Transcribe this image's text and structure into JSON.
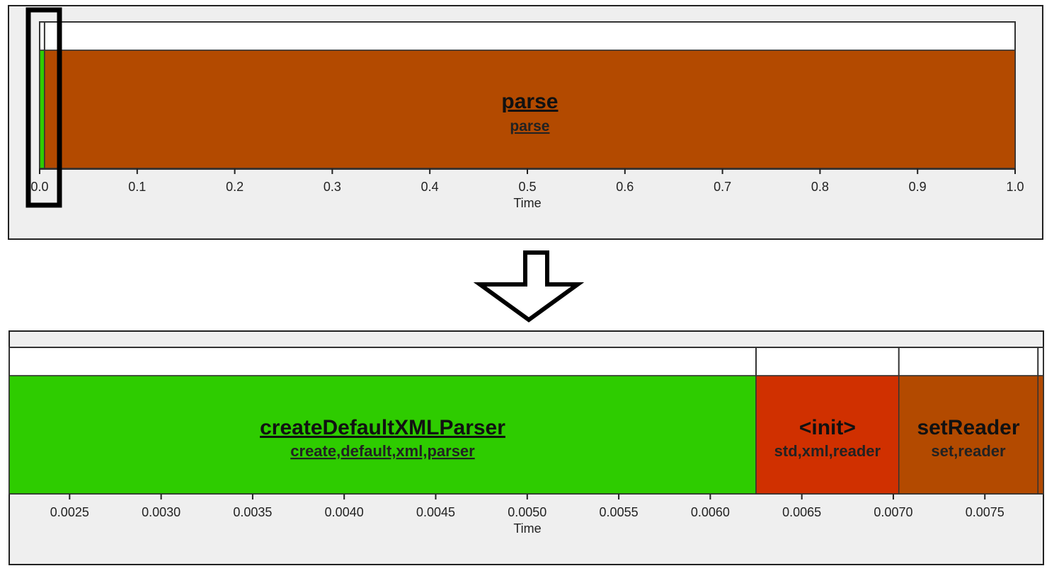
{
  "chart_data": [
    {
      "type": "timeline",
      "xlabel": "Time",
      "xlim": [
        0.0,
        1.0
      ],
      "ticks": [
        {
          "value": 0.0,
          "label": "0.0"
        },
        {
          "value": 0.1,
          "label": "0.1"
        },
        {
          "value": 0.2,
          "label": "0.2"
        },
        {
          "value": 0.3,
          "label": "0.3"
        },
        {
          "value": 0.4,
          "label": "0.4"
        },
        {
          "value": 0.5,
          "label": "0.5"
        },
        {
          "value": 0.6,
          "label": "0.6"
        },
        {
          "value": 0.7,
          "label": "0.7"
        },
        {
          "value": 0.8,
          "label": "0.8"
        },
        {
          "value": 0.9,
          "label": "0.9"
        },
        {
          "value": 1.0,
          "label": "1.0"
        }
      ],
      "bars": [
        {
          "name": "",
          "tags": "",
          "start": 0.0,
          "end": 0.005,
          "color": "#2ecc00"
        },
        {
          "name": "parse",
          "tags": "parse",
          "start": 0.005,
          "end": 1.0,
          "color": "#b34a00",
          "underlined": true
        }
      ],
      "highlight_range": [
        0.0,
        0.008
      ]
    },
    {
      "type": "timeline",
      "xlabel": "Time",
      "xlim": [
        0.00217,
        0.00782
      ],
      "ticks": [
        {
          "value": 0.0025,
          "label": "0.0025"
        },
        {
          "value": 0.003,
          "label": "0.0030"
        },
        {
          "value": 0.0035,
          "label": "0.0035"
        },
        {
          "value": 0.004,
          "label": "0.0040"
        },
        {
          "value": 0.0045,
          "label": "0.0045"
        },
        {
          "value": 0.005,
          "label": "0.0050"
        },
        {
          "value": 0.0055,
          "label": "0.0055"
        },
        {
          "value": 0.006,
          "label": "0.0060"
        },
        {
          "value": 0.0065,
          "label": "0.0065"
        },
        {
          "value": 0.007,
          "label": "0.0070"
        },
        {
          "value": 0.0075,
          "label": "0.0075"
        }
      ],
      "bars": [
        {
          "name": "createDefaultXMLParser",
          "tags": "create,default,xml,parser",
          "start": 0.00217,
          "end": 0.00625,
          "color": "#2ecc00",
          "underlined": true
        },
        {
          "name": "<init>",
          "tags": "std,xml,reader",
          "start": 0.00625,
          "end": 0.00703,
          "color": "#d03000",
          "underlined": false
        },
        {
          "name": "setReader",
          "tags": "set,reader",
          "start": 0.00703,
          "end": 0.00779,
          "color": "#b34a00",
          "underlined": false
        },
        {
          "name": "",
          "tags": "",
          "start": 0.00779,
          "end": 0.00782,
          "color": "#b34a00"
        }
      ]
    }
  ]
}
